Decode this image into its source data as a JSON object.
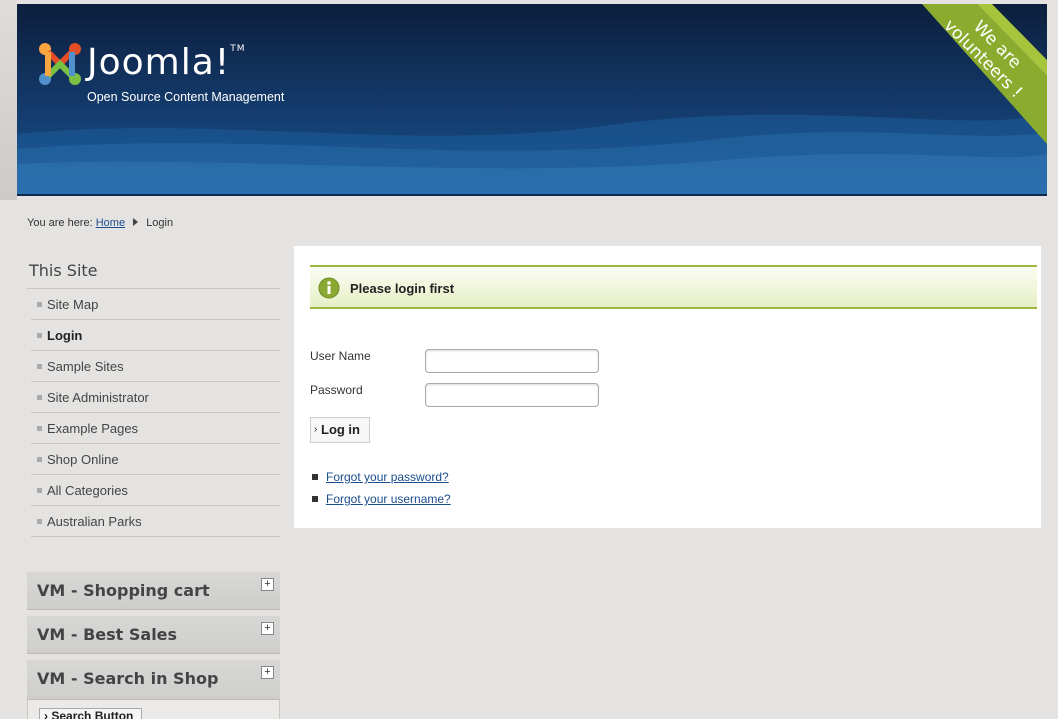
{
  "header": {
    "logo_text": "Joomla!",
    "tagline": "Open Source Content Management",
    "ribbon_line1": "We are",
    "ribbon_line2": "volunteers !",
    "colors": {
      "header_dark": "#0c1e3c",
      "header_light": "#1c5a98",
      "ribbon": "#8aab2e"
    }
  },
  "breadcrumb": {
    "prefix": "You are here:",
    "home": "Home",
    "current": "Login"
  },
  "sidebar": {
    "title": "This Site",
    "items": [
      {
        "label": "Site Map",
        "active": false
      },
      {
        "label": "Login",
        "active": true
      },
      {
        "label": "Sample Sites",
        "active": false
      },
      {
        "label": "Site Administrator",
        "active": false
      },
      {
        "label": "Example Pages",
        "active": false
      },
      {
        "label": "Shop Online",
        "active": false
      },
      {
        "label": "All Categories",
        "active": false
      },
      {
        "label": "Australian Parks",
        "active": false
      }
    ],
    "modules": [
      {
        "title": "VM - Shopping cart",
        "toggle": "+"
      },
      {
        "title": "VM - Best Sales",
        "toggle": "+"
      },
      {
        "title": "VM - Search in Shop",
        "toggle": "+"
      }
    ],
    "search_button": "Search Button"
  },
  "main": {
    "notice": "Please login first",
    "username_label": "User Name",
    "username_value": "",
    "password_label": "Password",
    "password_value": "",
    "login_button": "Log in",
    "links": [
      "Forgot your password?",
      "Forgot your username?"
    ],
    "notice_color": "#9bb73d"
  }
}
